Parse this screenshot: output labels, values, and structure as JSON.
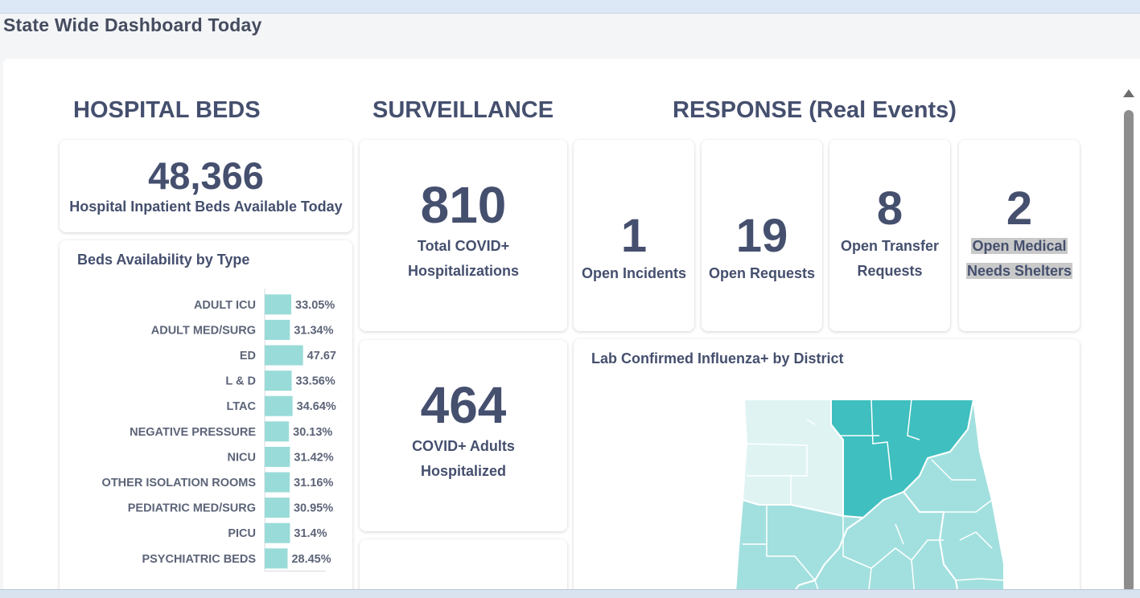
{
  "page": {
    "title": "State Wide Dashboard Today"
  },
  "sections": {
    "beds": "HOSPITAL BEDS",
    "surveillance": "SURVEILLANCE",
    "response": "RESPONSE (Real Events)"
  },
  "beds_available": {
    "value": "48,366",
    "label": "Hospital Inpatient Beds Available Today"
  },
  "surveillance": {
    "total": {
      "value": "810",
      "line1": "Total COVID+",
      "line2": "Hospitalizations"
    },
    "adults": {
      "value": "464",
      "line1": "COVID+ Adults",
      "line2": "Hospitalized"
    }
  },
  "response": {
    "incidents": {
      "value": "1",
      "label": "Open Incidents"
    },
    "requests": {
      "value": "19",
      "label": "Open Requests"
    },
    "transfers": {
      "value": "8",
      "line1": "Open Transfer",
      "line2": "Requests"
    },
    "shelters": {
      "value": "2",
      "line1": "Open Medical",
      "line2": "Needs Shelters"
    }
  },
  "map": {
    "title": "Lab Confirmed Influenza+ by District",
    "colors": {
      "dark": "#3fbfbf",
      "mid": "#a2e0df",
      "light": "#dff3f3"
    }
  },
  "chart_data": {
    "type": "bar",
    "orientation": "horizontal",
    "title": "Beds Availability by Type",
    "categories": [
      "ADULT ICU",
      "ADULT MED/SURG",
      "ED",
      "L & D",
      "LTAC",
      "NEGATIVE PRESSURE",
      "NICU",
      "OTHER ISOLATION ROOMS",
      "PEDIATRIC MED/SURG",
      "PICU",
      "PSYCHIATRIC BEDS"
    ],
    "values": [
      33.05,
      31.34,
      47.67,
      33.56,
      34.64,
      30.13,
      31.42,
      31.16,
      30.95,
      31.4,
      28.45
    ],
    "labels": [
      "33.05%",
      "31.34%",
      "47.67",
      "33.56%",
      "34.64%",
      "30.13%",
      "31.42%",
      "31.16%",
      "30.95%",
      "31.4%",
      "28.45%"
    ],
    "bar_color": "#99dbd8"
  }
}
